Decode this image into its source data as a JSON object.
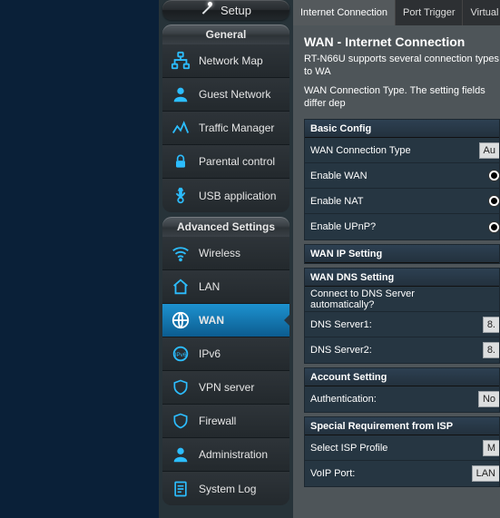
{
  "setup": {
    "label": "Setup"
  },
  "section_general": "General",
  "section_advanced": "Advanced Settings",
  "nav_general": [
    {
      "label": "Network Map",
      "icon": "network-map-icon"
    },
    {
      "label": "Guest Network",
      "icon": "guest-network-icon"
    },
    {
      "label": "Traffic Manager",
      "icon": "traffic-manager-icon"
    },
    {
      "label": "Parental control",
      "icon": "parental-control-icon"
    },
    {
      "label": "USB application",
      "icon": "usb-icon"
    }
  ],
  "nav_advanced": [
    {
      "label": "Wireless",
      "icon": "wireless-icon"
    },
    {
      "label": "LAN",
      "icon": "lan-icon"
    },
    {
      "label": "WAN",
      "icon": "wan-icon",
      "active": true
    },
    {
      "label": "IPv6",
      "icon": "ipv6-icon"
    },
    {
      "label": "VPN server",
      "icon": "vpn-icon"
    },
    {
      "label": "Firewall",
      "icon": "firewall-icon"
    },
    {
      "label": "Administration",
      "icon": "administration-icon"
    },
    {
      "label": "System Log",
      "icon": "system-log-icon"
    }
  ],
  "tabs": [
    {
      "label": "Internet Connection",
      "active": true
    },
    {
      "label": "Port Trigger"
    },
    {
      "label": "Virtual"
    }
  ],
  "page": {
    "title": "WAN - Internet Connection",
    "desc_line1": "RT-N66U supports several connection types to WA",
    "desc_line2": "WAN Connection Type. The setting fields differ dep"
  },
  "sections": {
    "basic": {
      "title": "Basic Config",
      "rows": {
        "wan_type": {
          "label": "WAN Connection Type",
          "value": "Au"
        },
        "enable_wan": {
          "label": "Enable WAN",
          "radio": true
        },
        "enable_nat": {
          "label": "Enable NAT",
          "radio": true
        },
        "enable_upnp": {
          "label": "Enable UPnP?",
          "radio": true
        }
      }
    },
    "wan_ip": {
      "title": "WAN IP Setting"
    },
    "wan_dns": {
      "title": "WAN DNS Setting",
      "rows": {
        "auto": {
          "label": "Connect to DNS Server automatically?"
        },
        "dns1": {
          "label": "DNS Server1:",
          "value": "8."
        },
        "dns2": {
          "label": "DNS Server2:",
          "value": "8."
        }
      }
    },
    "account": {
      "title": "Account Setting",
      "rows": {
        "auth": {
          "label": "Authentication:",
          "value": "No"
        }
      }
    },
    "isp": {
      "title": "Special Requirement from ISP",
      "rows": {
        "profile": {
          "label": "Select ISP Profile",
          "value": "M"
        },
        "voip": {
          "label": "VoIP Port:",
          "value": "LAN"
        }
      }
    }
  }
}
